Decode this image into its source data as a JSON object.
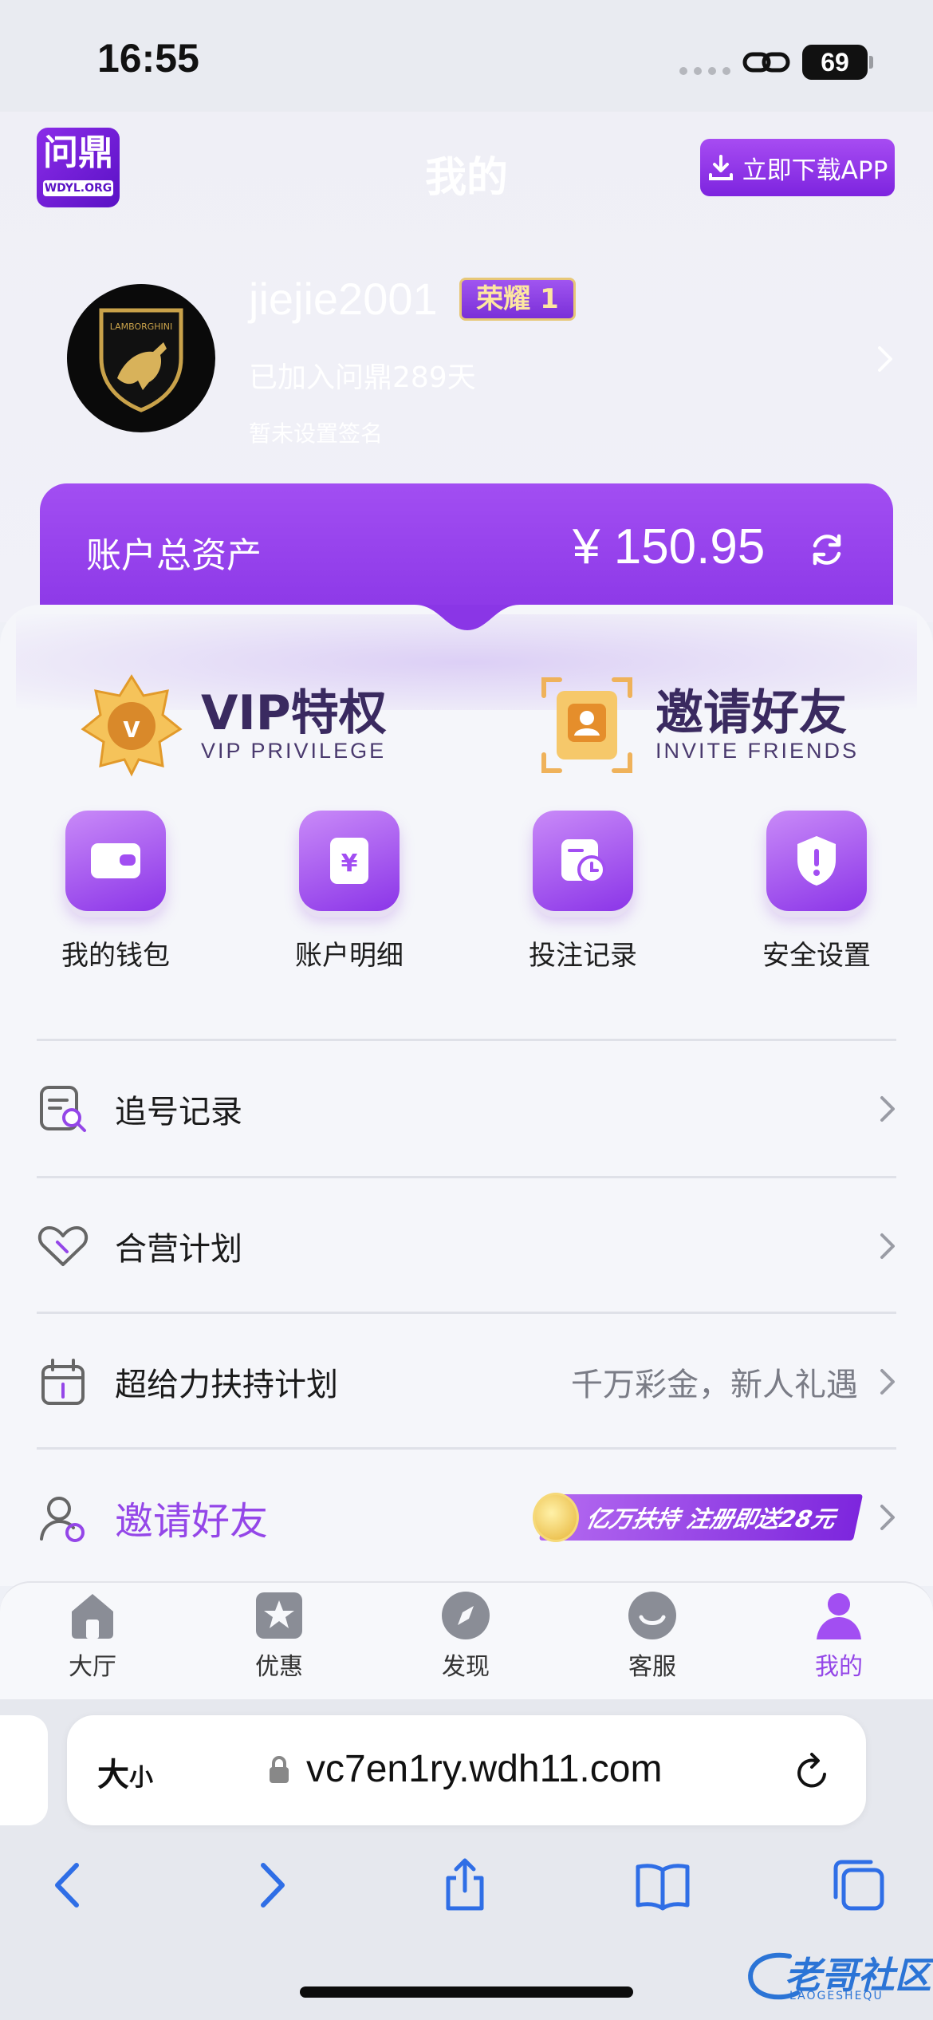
{
  "status_bar": {
    "time": "16:55",
    "battery": "69"
  },
  "header": {
    "logo_title": "问鼎",
    "logo_subtitle": "WDYL.ORG",
    "page_title": "我的",
    "download_label": "立即下载APP"
  },
  "profile": {
    "avatar_text": "LAMBORGHINI",
    "username": "jiejie2001",
    "rank_badge": "荣耀 1",
    "join_days": "已加入问鼎289天",
    "signature": "暂未设置签名"
  },
  "assets": {
    "label": "账户总资产",
    "value": "¥ 150.95"
  },
  "features": {
    "vip": {
      "title": "VIP特权",
      "subtitle": "VIP PRIVILEGE"
    },
    "invite": {
      "title": "邀请好友",
      "subtitle": "INVITE FRIENDS"
    }
  },
  "quick_actions": [
    {
      "label": "我的钱包",
      "icon": "wallet-icon"
    },
    {
      "label": "账户明细",
      "icon": "ledger-icon"
    },
    {
      "label": "投注记录",
      "icon": "bet-record-icon"
    },
    {
      "label": "安全设置",
      "icon": "shield-icon"
    }
  ],
  "menu": {
    "chase": {
      "label": "追号记录"
    },
    "joint": {
      "label": "合营计划"
    },
    "support": {
      "label": "超给力扶持计划",
      "note": "千万彩金，新人礼遇"
    },
    "invite": {
      "label": "邀请好友",
      "banner": "亿万扶持 注册即送28元"
    }
  },
  "tabs": [
    {
      "label": "大厅",
      "icon": "home-icon"
    },
    {
      "label": "优惠",
      "icon": "star-icon"
    },
    {
      "label": "发现",
      "icon": "compass-icon"
    },
    {
      "label": "客服",
      "icon": "service-icon"
    },
    {
      "label": "我的",
      "icon": "user-icon",
      "active": true
    }
  ],
  "browser": {
    "text_size_big": "大",
    "text_size_small": "小",
    "url": "vc7en1ry.wdh11.com"
  },
  "watermark": {
    "text": "老哥社区",
    "sub": "LAOGESHEQU"
  },
  "colors": {
    "accent": "#9446e8",
    "card_gradient_start": "#a24ef2",
    "card_gradient_end": "#8a36e6"
  }
}
